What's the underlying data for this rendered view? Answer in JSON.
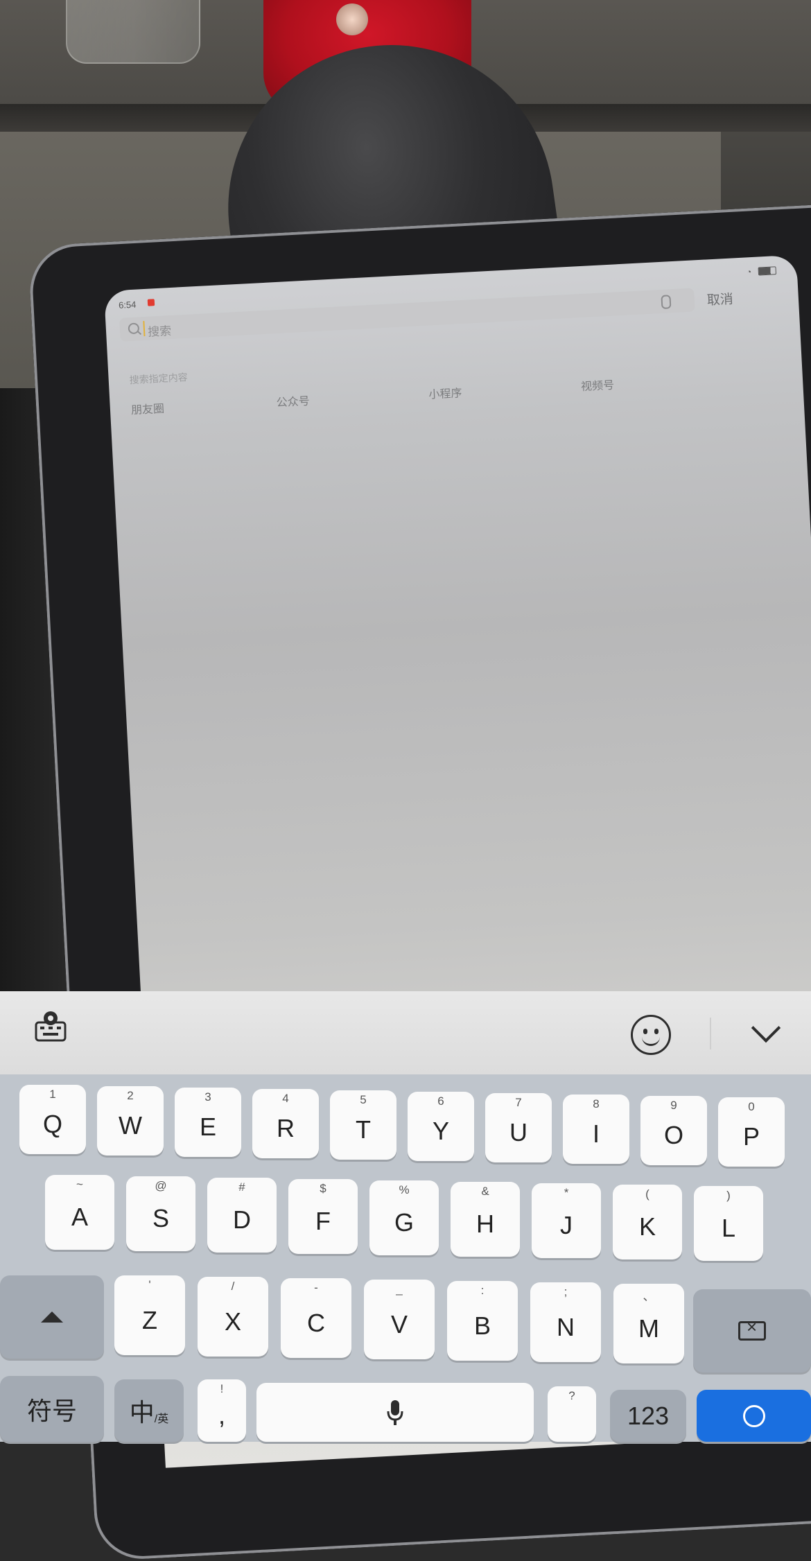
{
  "status_bar": {
    "time": "6:54"
  },
  "search": {
    "placeholder": "搜索",
    "cancel_label": "取消",
    "hint": "搜索指定内容",
    "categories": [
      "朋友圈",
      "公众号",
      "小程序",
      "视频号"
    ]
  },
  "keyboard": {
    "row1": [
      {
        "sub": "1",
        "main": "Q"
      },
      {
        "sub": "2",
        "main": "W"
      },
      {
        "sub": "3",
        "main": "E"
      },
      {
        "sub": "4",
        "main": "R"
      },
      {
        "sub": "5",
        "main": "T"
      },
      {
        "sub": "6",
        "main": "Y"
      },
      {
        "sub": "7",
        "main": "U"
      },
      {
        "sub": "8",
        "main": "I"
      },
      {
        "sub": "9",
        "main": "O"
      },
      {
        "sub": "0",
        "main": "P"
      }
    ],
    "row2": [
      {
        "sub": "~",
        "main": "A"
      },
      {
        "sub": "@",
        "main": "S"
      },
      {
        "sub": "#",
        "main": "D"
      },
      {
        "sub": "$",
        "main": "F"
      },
      {
        "sub": "%",
        "main": "G"
      },
      {
        "sub": "&",
        "main": "H"
      },
      {
        "sub": "*",
        "main": "J"
      },
      {
        "sub": "(",
        "main": "K"
      },
      {
        "sub": ")",
        "main": "L"
      }
    ],
    "row3": [
      {
        "sub": "'",
        "main": "Z"
      },
      {
        "sub": "/",
        "main": "X"
      },
      {
        "sub": "-",
        "main": "C"
      },
      {
        "sub": "_",
        "main": "V"
      },
      {
        "sub": ":",
        "main": "B"
      },
      {
        "sub": ";",
        "main": "N"
      },
      {
        "sub": "、",
        "main": "M"
      }
    ],
    "symbols_label": "符号",
    "lang_label": "中",
    "lang_sub": "/英",
    "comma_sub": "!",
    "comma_main": ",",
    "question_sub": "?",
    "numbers_label": "123"
  },
  "colors": {
    "enter_key": "#1a6fe0",
    "status_dot": "#e13b30"
  }
}
